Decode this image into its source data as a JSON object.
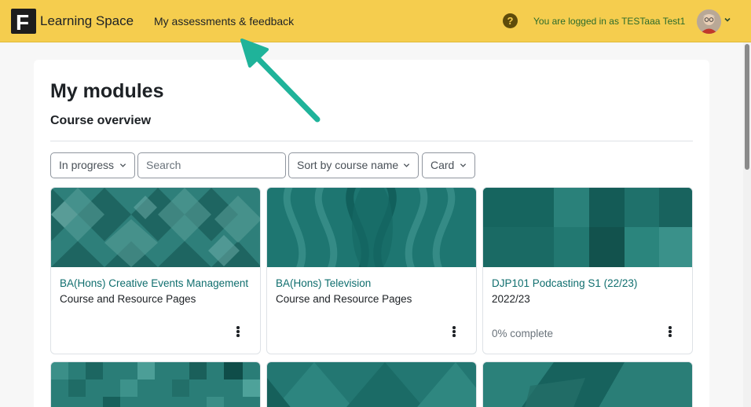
{
  "navbar": {
    "logo_letter": "F",
    "brand": "Learning Space",
    "nav_link": "My assessments & feedback",
    "help_symbol": "?",
    "login_text": "You are logged in as TESTaaa Test1",
    "accent_color": "#f5cd4e"
  },
  "page": {
    "title": "My modules",
    "section_title": "Course overview"
  },
  "filters": {
    "status": "In progress",
    "search_placeholder": "Search",
    "sort": "Sort by course name",
    "view": "Card"
  },
  "courses": [
    {
      "name": "BA(Hons) Creative Events Management",
      "category": "Course and Resource Pages",
      "progress": ""
    },
    {
      "name": "BA(Hons) Television",
      "category": "Course and Resource Pages",
      "progress": ""
    },
    {
      "name": "DJP101 Podcasting S1 (22/23)",
      "category": "2022/23",
      "progress": "0% complete"
    }
  ],
  "colors": {
    "course_link": "#0f6e6e",
    "teal": "#17756f",
    "annotation_arrow": "#1fb39a"
  }
}
